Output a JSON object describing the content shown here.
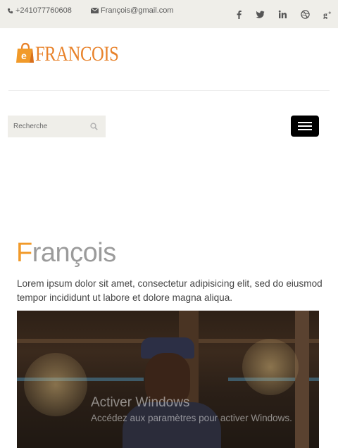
{
  "topbar": {
    "phone": "+241077760608",
    "email": "François@gmail.com",
    "social_icons": [
      "facebook-icon",
      "twitter-icon",
      "linkedin-icon",
      "dribbble-icon",
      "google-plus-icon"
    ]
  },
  "brand": {
    "logo_text": "FRANCOIS",
    "logo_badge": "e",
    "accent": "#f19a2a"
  },
  "search": {
    "placeholder": "Recherche"
  },
  "hero": {
    "title_first_letter": "F",
    "title_rest": "rançois",
    "lead": "Lorem ipsum dolor sit amet, consectetur adipisicing elit, sed do eiusmod tempor incididunt ut labore et dolore magna aliqua."
  },
  "watermark": {
    "line1": "Activer Windows",
    "line2": "Accédez aux paramètres pour activer Windows."
  },
  "colors": {
    "topbar_bg": "#efeee9",
    "menu_button": "#000000",
    "title_gray": "#9b9b9b"
  }
}
